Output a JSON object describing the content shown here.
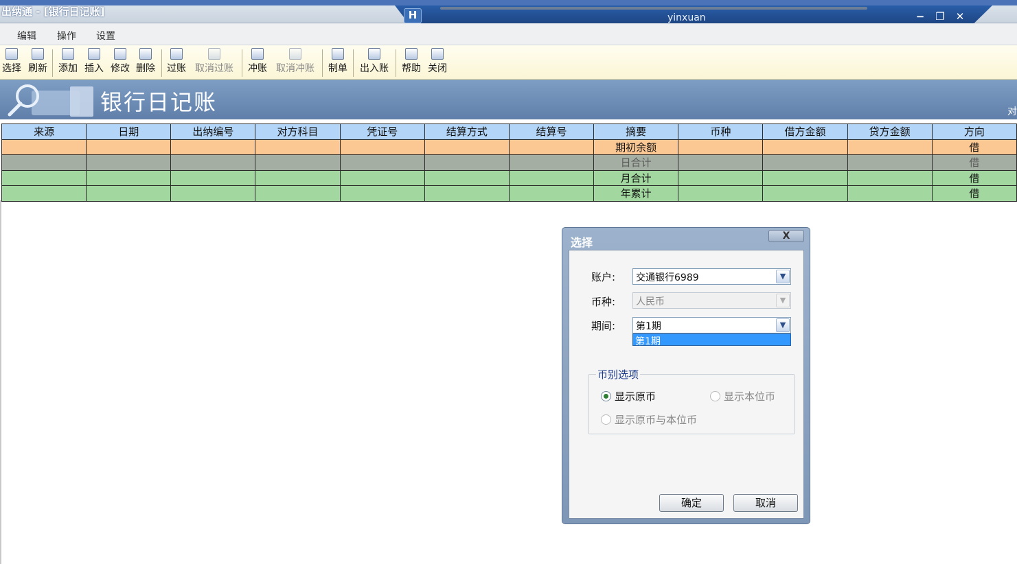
{
  "window": {
    "title": "出纳通 - [银行日记账]",
    "user": "yinxuan",
    "pin_label": "H",
    "minimize": "−",
    "restore": "❐",
    "close": "✕"
  },
  "menu": [
    "编辑",
    "操作",
    "设置"
  ],
  "toolbar": [
    {
      "label": "选择",
      "icon": "select-icon"
    },
    {
      "label": "刷新",
      "icon": "refresh-icon"
    },
    {
      "label": "添加",
      "icon": "add-icon"
    },
    {
      "label": "插入",
      "icon": "insert-icon"
    },
    {
      "label": "修改",
      "icon": "edit-icon"
    },
    {
      "label": "删除",
      "icon": "delete-icon"
    },
    {
      "label": "过账",
      "icon": "post-icon"
    },
    {
      "label": "取消过账",
      "icon": "unpost-icon"
    },
    {
      "label": "冲账",
      "icon": "reverse-icon"
    },
    {
      "label": "取消冲账",
      "icon": "unreverse-icon"
    },
    {
      "label": "制单",
      "icon": "voucher-icon"
    },
    {
      "label": "出入账",
      "icon": "inout-icon"
    },
    {
      "label": "帮助",
      "icon": "help-icon"
    },
    {
      "label": "关闭",
      "icon": "close-doc-icon"
    }
  ],
  "banner": {
    "title": "银行日记账",
    "edge_text": "对"
  },
  "table": {
    "columns": [
      "来源",
      "日期",
      "出纳编号",
      "对方科目",
      "凭证号",
      "结算方式",
      "结算号",
      "摘要",
      "币种",
      "借方金额",
      "贷方金额",
      "方向"
    ],
    "rows": [
      {
        "summary": "期初余额",
        "direction": "借"
      },
      {
        "summary": "日合计",
        "direction": "借"
      },
      {
        "summary": "月合计",
        "direction": "借"
      },
      {
        "summary": "年累计",
        "direction": "借"
      }
    ]
  },
  "dialog": {
    "title": "选择",
    "close_label": "X",
    "account_label": "账户:",
    "account_value": "交通银行6989",
    "currency_label": "币种:",
    "currency_value": "人民币",
    "period_label": "期间:",
    "period_value": "第1期",
    "period_dropdown_item": "第1期",
    "group_title": "币别选项",
    "radio_original": "显示原币",
    "radio_local": "显示本位币",
    "radio_both": "显示原币与本位币",
    "ok": "确定",
    "cancel": "取消"
  },
  "colors": {
    "header_bg": "#b3d5f7",
    "opening_row": "#fbc894",
    "day_row": "#a4aea2",
    "total_rows": "#a2d8a0",
    "banner": "#6f8fb8"
  }
}
